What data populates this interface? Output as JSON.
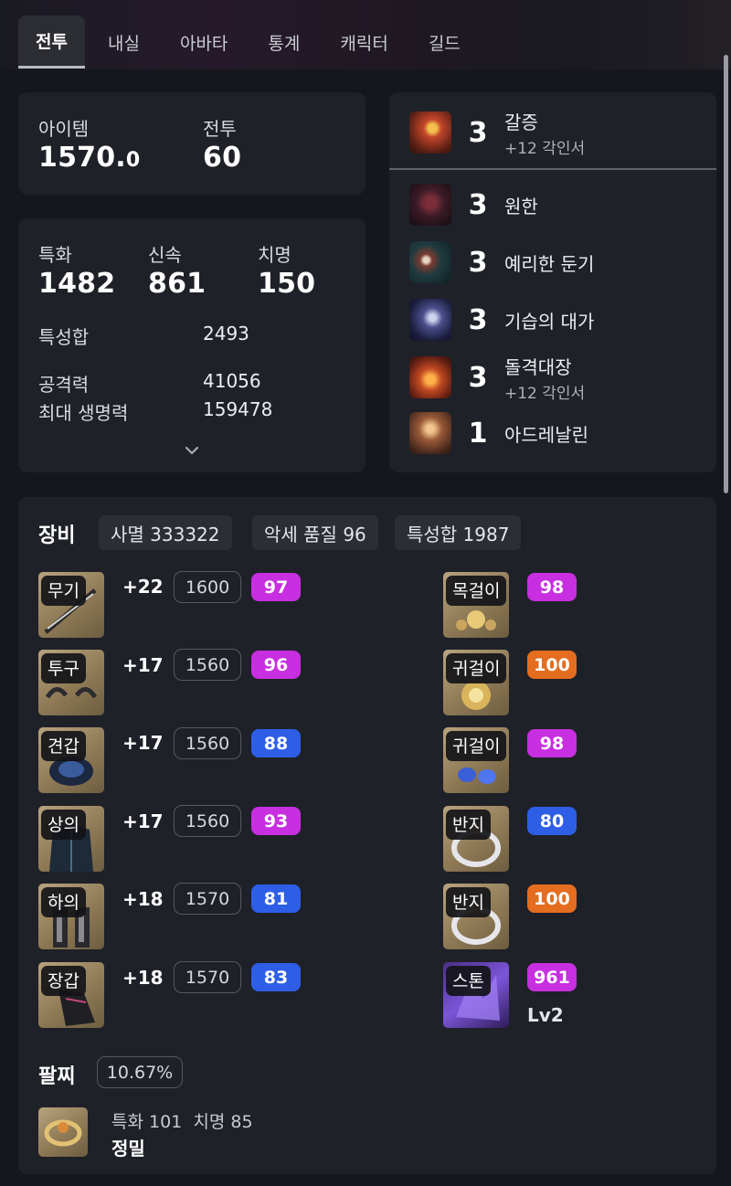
{
  "tabs": [
    "전투",
    "내실",
    "아바타",
    "통계",
    "캐릭터",
    "길드"
  ],
  "summary": {
    "item_label": "아이템",
    "item_level_main": "1570.",
    "item_level_decimal": "0",
    "combat_label": "전투",
    "combat_level": "60"
  },
  "stats": {
    "spec_label": "특화",
    "spec_value": "1482",
    "swift_label": "신속",
    "swift_value": "861",
    "crit_label": "치명",
    "crit_value": "150",
    "total_label": "특성합",
    "total_value": "2493",
    "atk_label": "공격력",
    "atk_value": "41056",
    "hp_label": "최대 생명력",
    "hp_value": "159478"
  },
  "engravings": [
    {
      "level": "3",
      "name": "갈증",
      "sub": "+12 각인서",
      "icon": "thirst-icon"
    },
    {
      "level": "3",
      "name": "원한",
      "sub": "",
      "icon": "grudge-icon"
    },
    {
      "level": "3",
      "name": "예리한 둔기",
      "sub": "",
      "icon": "keen-blunt-icon"
    },
    {
      "level": "3",
      "name": "기습의 대가",
      "sub": "",
      "icon": "ambush-master-icon"
    },
    {
      "level": "3",
      "name": "돌격대장",
      "sub": "+12 각인서",
      "icon": "raid-captain-icon"
    },
    {
      "level": "1",
      "name": "아드레날린",
      "sub": "",
      "icon": "adrenaline-icon"
    }
  ],
  "equipment": {
    "title": "장비",
    "chips": [
      "사멸 333322",
      "악세 품질 96",
      "특성합 1987"
    ],
    "gear": [
      {
        "slot": "무기",
        "plus": "+22",
        "level": "1600",
        "quality": "97",
        "color": "#c72fe0"
      },
      {
        "slot": "투구",
        "plus": "+17",
        "level": "1560",
        "quality": "96",
        "color": "#c72fe0"
      },
      {
        "slot": "견갑",
        "plus": "+17",
        "level": "1560",
        "quality": "88",
        "color": "#2e5ee6"
      },
      {
        "slot": "상의",
        "plus": "+17",
        "level": "1560",
        "quality": "93",
        "color": "#c72fe0"
      },
      {
        "slot": "하의",
        "plus": "+18",
        "level": "1570",
        "quality": "81",
        "color": "#2e5ee6"
      },
      {
        "slot": "장갑",
        "plus": "+18",
        "level": "1570",
        "quality": "83",
        "color": "#2e5ee6"
      }
    ],
    "accessories": [
      {
        "slot": "목걸이",
        "quality": "98",
        "color": "#c72fe0"
      },
      {
        "slot": "귀걸이",
        "quality": "100",
        "color": "#e46d1f"
      },
      {
        "slot": "귀걸이",
        "quality": "98",
        "color": "#c72fe0"
      },
      {
        "slot": "반지",
        "quality": "80",
        "color": "#2e5ee6"
      },
      {
        "slot": "반지",
        "quality": "100",
        "color": "#e46d1f"
      },
      {
        "slot": "스톤",
        "quality": "961",
        "color": "#c72fe0",
        "extra": "Lv2"
      }
    ]
  },
  "bracelet": {
    "title": "팔찌",
    "percent": "10.67%",
    "stat1": "특화 101",
    "stat2": "치명 85",
    "effect": "정밀"
  }
}
